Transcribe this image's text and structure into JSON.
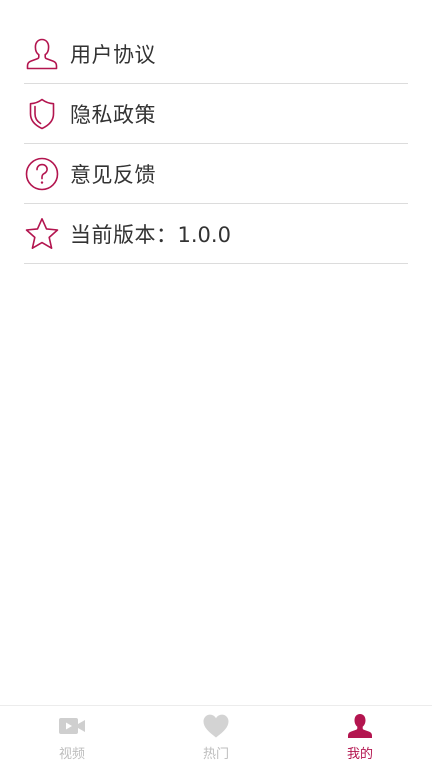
{
  "colors": {
    "accent": "#b3154f",
    "text": "#333333",
    "divider": "#dcdcdc",
    "tab_inactive": "#bdbdbd",
    "tab_active": "#b3154f"
  },
  "menu": {
    "items": [
      {
        "icon": "user-icon",
        "label": "用户协议"
      },
      {
        "icon": "shield-icon",
        "label": "隐私政策"
      },
      {
        "icon": "question-icon",
        "label": "意见反馈"
      },
      {
        "icon": "star-icon",
        "label": "当前版本：",
        "value": "1.0.0"
      }
    ]
  },
  "tabbar": {
    "active_index": 2,
    "tabs": [
      {
        "icon": "video-icon",
        "label": "视频"
      },
      {
        "icon": "heart-icon",
        "label": "热门"
      },
      {
        "icon": "person-icon",
        "label": "我的"
      }
    ]
  }
}
